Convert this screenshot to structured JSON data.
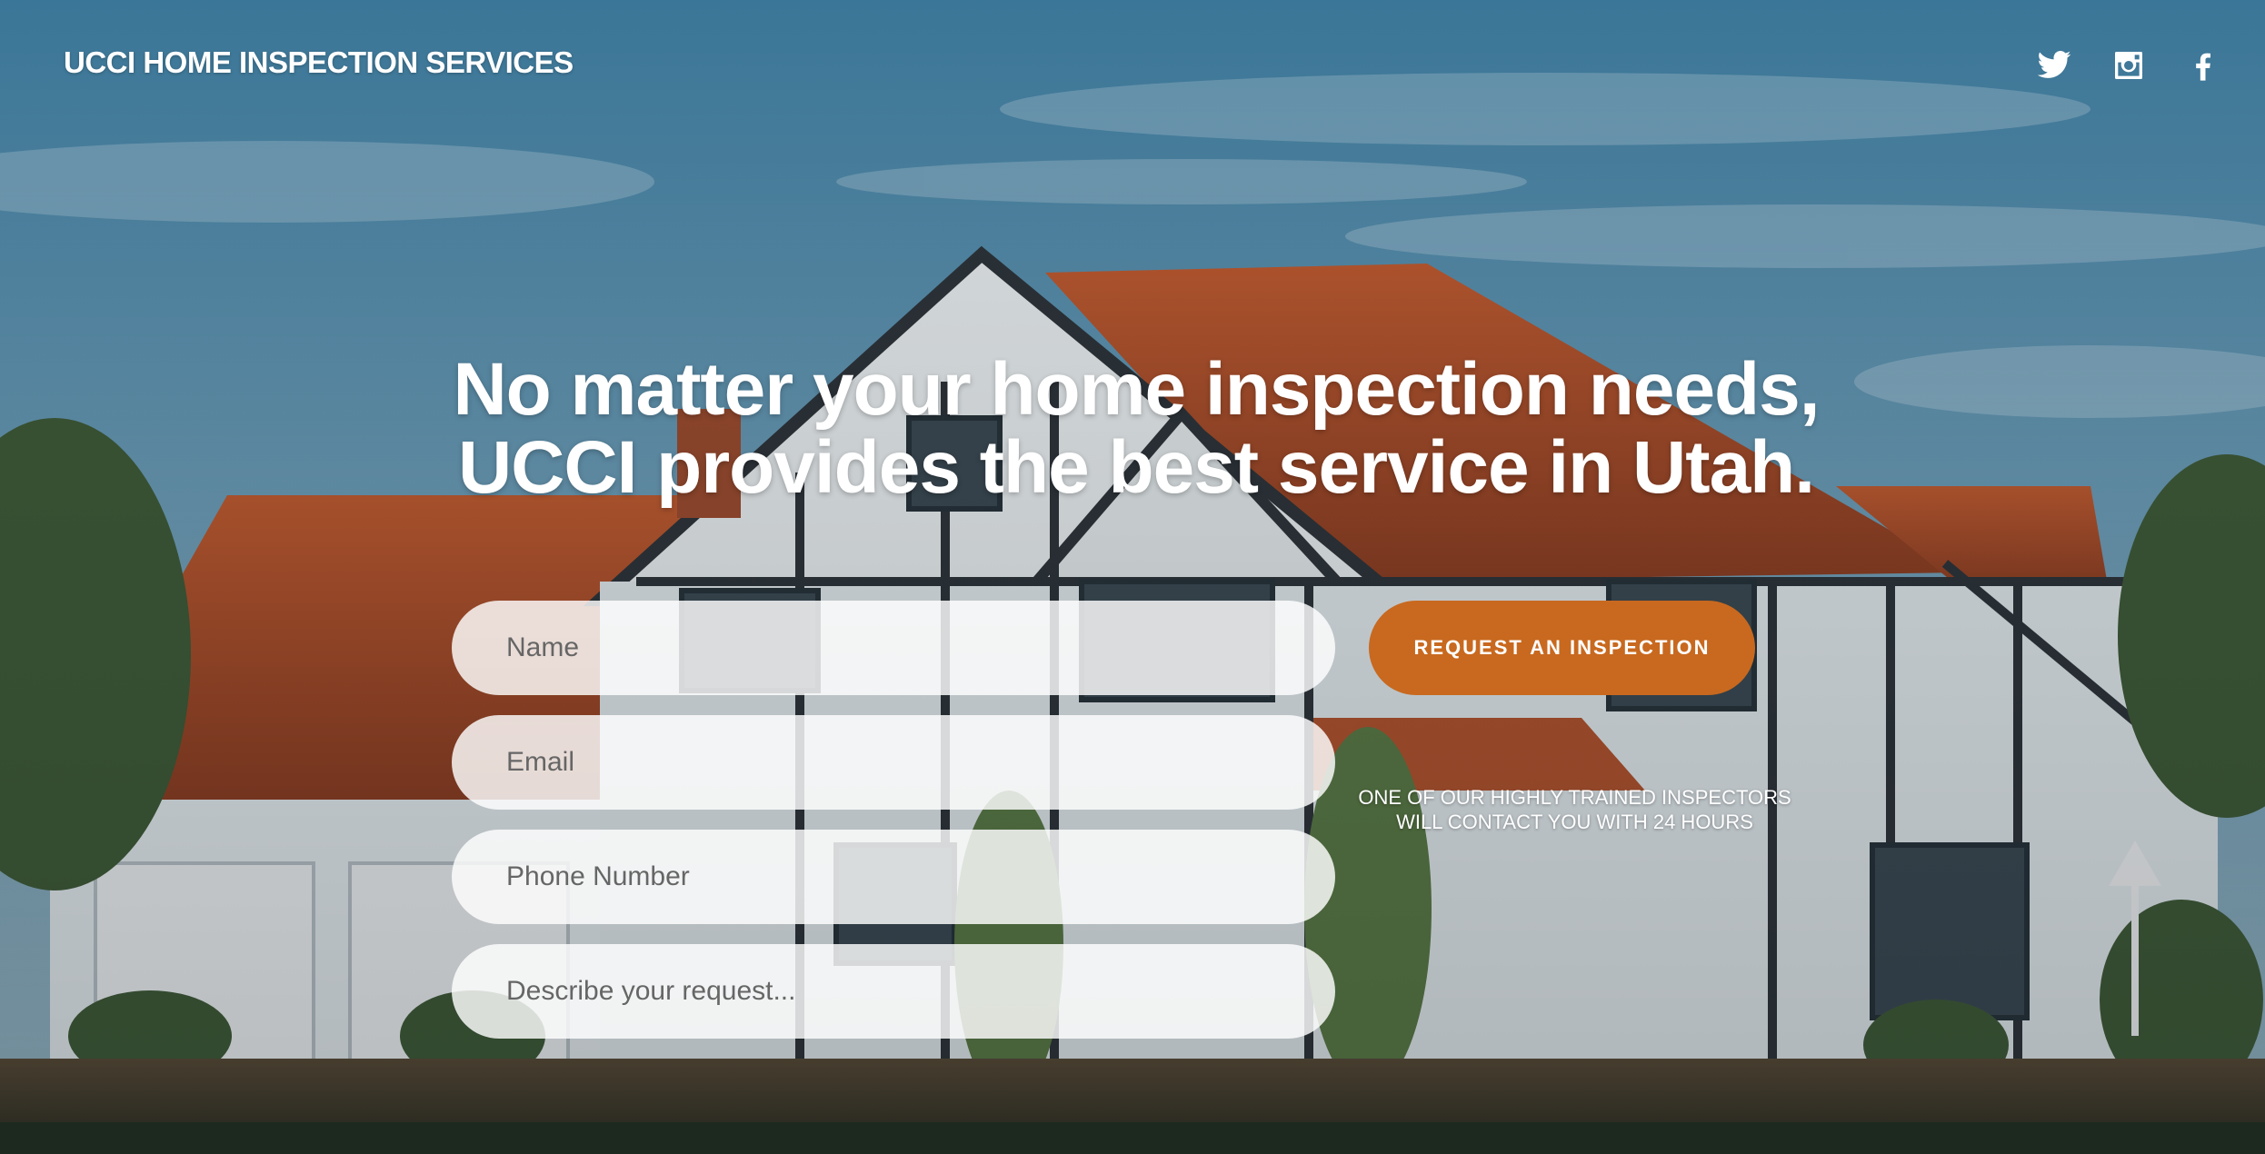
{
  "brand": {
    "title": "UCCI HOME INSPECTION SERVICES"
  },
  "social": [
    {
      "icon": "twitter-icon",
      "label": "Twitter"
    },
    {
      "icon": "instagram-icon",
      "label": "Instagram"
    },
    {
      "icon": "facebook-icon",
      "label": "Facebook"
    }
  ],
  "hero": {
    "line1": "No matter your home inspection needs,",
    "line2": "UCCI provides the best service in Utah."
  },
  "form": {
    "name_placeholder": "Name",
    "email_placeholder": "Email",
    "phone_placeholder": "Phone Number",
    "description_placeholder": "Describe your request...",
    "submit_label": "REQUEST AN INSPECTION",
    "note_line1": "ONE OF OUR HIGHLY TRAINED INSPECTORS",
    "note_line2": "WILL CONTACT YOU WITH 24 HOURS"
  },
  "colors": {
    "accent": "#c8691f",
    "sky": "#4a86a6",
    "roof": "#b5522a",
    "text": "#ffffff"
  }
}
